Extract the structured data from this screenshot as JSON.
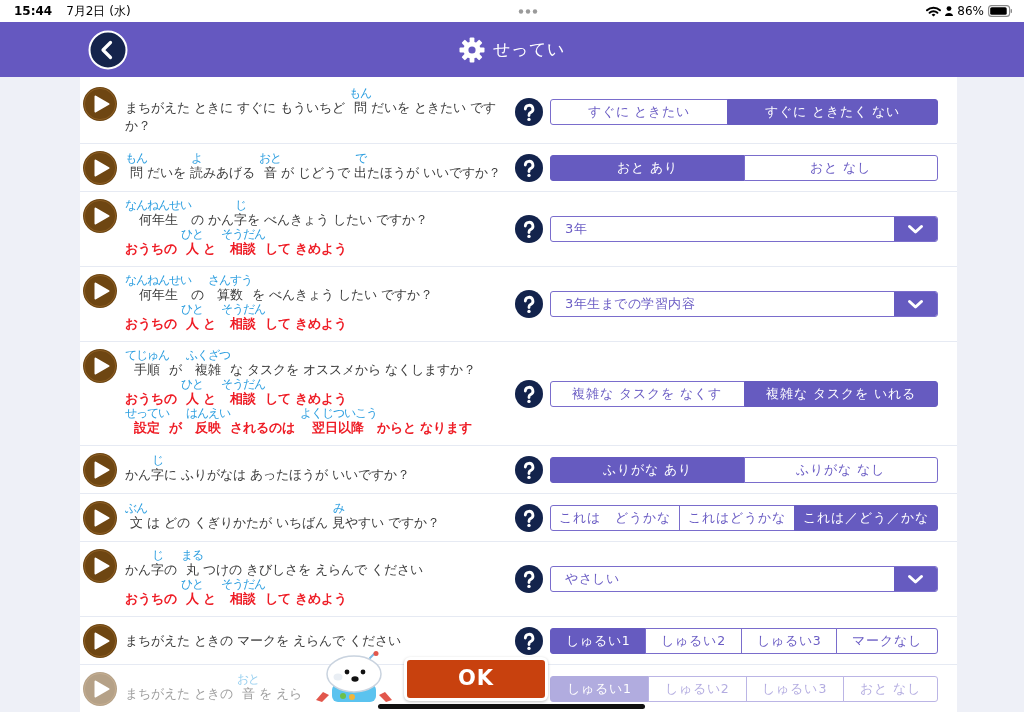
{
  "status_bar": {
    "time": "15:44",
    "date": "7月2日 (水)",
    "battery": "86%"
  },
  "header": {
    "title": "せってい"
  },
  "settings": [
    {
      "kind": "choice",
      "question": [
        {
          "text": "まちがえた ときに すぐに もういちど "
        },
        {
          "text": "問",
          "ruby": "もん"
        },
        {
          "text": "だいを ときたい ですか？"
        }
      ],
      "options": [
        {
          "label": "すぐに ときたい",
          "selected": false
        },
        {
          "label": "すぐに ときたく ない",
          "selected": true
        }
      ]
    },
    {
      "kind": "choice",
      "question": [
        {
          "text": "問",
          "ruby": "もん"
        },
        {
          "text": "だいを "
        },
        {
          "text": "読",
          "ruby": "よ"
        },
        {
          "text": "みあげる "
        },
        {
          "text": "音",
          "ruby": "おと"
        },
        {
          "text": "が じどうで "
        },
        {
          "text": "出",
          "ruby": "で"
        },
        {
          "text": "たほうが いいですか？"
        }
      ],
      "options": [
        {
          "label": "おと あり",
          "selected": true
        },
        {
          "label": "おと なし",
          "selected": false
        }
      ]
    },
    {
      "kind": "dropdown",
      "question": [
        {
          "text": "何年生",
          "ruby": "なんねんせい"
        },
        {
          "text": "の かん"
        },
        {
          "text": "字",
          "ruby": "じ"
        },
        {
          "text": "を べんきょう したい ですか？"
        }
      ],
      "notes": [
        [
          {
            "text": "おうちの "
          },
          {
            "text": "人",
            "ruby": "ひと"
          },
          {
            "text": "と "
          },
          {
            "text": "相談",
            "ruby": "そうだん"
          },
          {
            "text": "して きめよう"
          }
        ]
      ],
      "value": "3年"
    },
    {
      "kind": "dropdown",
      "question": [
        {
          "text": "何年生",
          "ruby": "なんねんせい"
        },
        {
          "text": "の "
        },
        {
          "text": "算数",
          "ruby": "さんすう"
        },
        {
          "text": "を べんきょう したい ですか？"
        }
      ],
      "notes": [
        [
          {
            "text": "おうちの "
          },
          {
            "text": "人",
            "ruby": "ひと"
          },
          {
            "text": "と "
          },
          {
            "text": "相談",
            "ruby": "そうだん"
          },
          {
            "text": "して きめよう"
          }
        ]
      ],
      "value": "3年生までの学習内容"
    },
    {
      "kind": "choice",
      "question": [
        {
          "text": "手順",
          "ruby": "てじゅん"
        },
        {
          "text": "が "
        },
        {
          "text": "複雑",
          "ruby": "ふくざつ"
        },
        {
          "text": "な タスクを オススメから なくしますか？"
        }
      ],
      "notes": [
        [
          {
            "text": "おうちの "
          },
          {
            "text": "人",
            "ruby": "ひと"
          },
          {
            "text": "と "
          },
          {
            "text": "相談",
            "ruby": "そうだん"
          },
          {
            "text": "して きめよう"
          }
        ],
        [
          {
            "text": "設定",
            "ruby": "せってい"
          },
          {
            "text": "が "
          },
          {
            "text": "反映",
            "ruby": "はんえい"
          },
          {
            "text": "されるのは "
          },
          {
            "text": "翌日以降",
            "ruby": "よくじついこう"
          },
          {
            "text": "からと なります"
          }
        ]
      ],
      "options": [
        {
          "label": "複雑な タスクを なくす",
          "selected": false
        },
        {
          "label": "複雑な タスクを いれる",
          "selected": true
        }
      ]
    },
    {
      "kind": "choice",
      "question": [
        {
          "text": "かん"
        },
        {
          "text": "字",
          "ruby": "じ"
        },
        {
          "text": "に ふりがなは あったほうが いいですか？"
        }
      ],
      "options": [
        {
          "label": "ふりがな あり",
          "selected": true
        },
        {
          "label": "ふりがな なし",
          "selected": false
        }
      ]
    },
    {
      "kind": "choice",
      "question": [
        {
          "text": "文",
          "ruby": "ぶん"
        },
        {
          "text": "は どの くぎりかたが いちばん "
        },
        {
          "text": "見",
          "ruby": "み"
        },
        {
          "text": "やすい ですか？"
        }
      ],
      "options": [
        {
          "label": "これは　どうかな",
          "selected": false
        },
        {
          "label": "これはどうかな",
          "selected": false
        },
        {
          "label": "これは／どう／かな",
          "selected": true
        }
      ]
    },
    {
      "kind": "dropdown",
      "question": [
        {
          "text": "かん"
        },
        {
          "text": "字",
          "ruby": "じ"
        },
        {
          "text": "の "
        },
        {
          "text": "丸",
          "ruby": "まる"
        },
        {
          "text": "つけの きびしさを えらんで ください"
        }
      ],
      "notes": [
        [
          {
            "text": "おうちの "
          },
          {
            "text": "人",
            "ruby": "ひと"
          },
          {
            "text": "と "
          },
          {
            "text": "相談",
            "ruby": "そうだん"
          },
          {
            "text": "して きめよう"
          }
        ]
      ],
      "value": "やさしい"
    },
    {
      "kind": "choice",
      "question": [
        {
          "text": "まちがえた ときの マークを えらんで ください"
        }
      ],
      "options": [
        {
          "label": "しゅるい1",
          "selected": true
        },
        {
          "label": "しゅるい2",
          "selected": false
        },
        {
          "label": "しゅるい3",
          "selected": false
        },
        {
          "label": "マークなし",
          "selected": false
        }
      ]
    },
    {
      "kind": "choice",
      "question": [
        {
          "text": "まちがえた ときの "
        },
        {
          "text": "音",
          "ruby": "おと"
        },
        {
          "text": "を えら"
        }
      ],
      "options": [
        {
          "label": "しゅるい1",
          "selected": true
        },
        {
          "label": "しゅるい2",
          "selected": false
        },
        {
          "label": "しゅるい3",
          "selected": false
        },
        {
          "label": "おと なし",
          "selected": false
        }
      ]
    }
  ],
  "ok_button": {
    "label": "OK"
  }
}
